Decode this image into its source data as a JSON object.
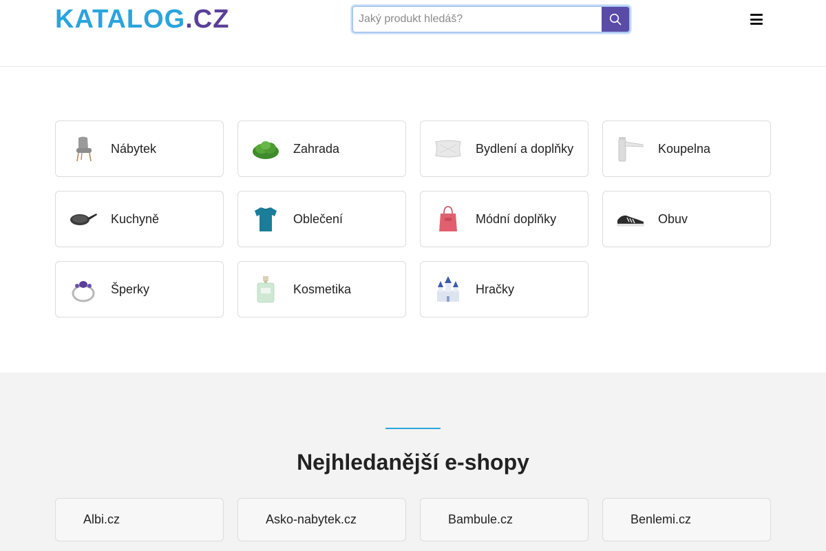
{
  "header": {
    "logo_main": "KATALOG",
    "logo_tld": ".CZ",
    "search_placeholder": "Jaký produkt hledáš?",
    "search_icon": "search-icon",
    "menu_icon": "hamburger-menu-icon"
  },
  "categories": [
    {
      "label": "Nábytek",
      "icon": "chair-icon"
    },
    {
      "label": "Zahrada",
      "icon": "shrub-icon"
    },
    {
      "label": "Bydlení a doplňky",
      "icon": "pillow-icon"
    },
    {
      "label": "Koupelna",
      "icon": "faucet-icon"
    },
    {
      "label": "Kuchyně",
      "icon": "frying-pan-icon"
    },
    {
      "label": "Oblečení",
      "icon": "tshirt-icon"
    },
    {
      "label": "Módní doplňky",
      "icon": "handbag-icon"
    },
    {
      "label": "Obuv",
      "icon": "sneaker-icon"
    },
    {
      "label": "Šperky",
      "icon": "ring-icon"
    },
    {
      "label": "Kosmetika",
      "icon": "perfume-icon"
    },
    {
      "label": "Hračky",
      "icon": "castle-toy-icon"
    }
  ],
  "shops_section": {
    "title": "Nejhledanější e-shopy",
    "shops": [
      {
        "label": "Albi.cz"
      },
      {
        "label": "Asko-nabytek.cz"
      },
      {
        "label": "Bambule.cz"
      },
      {
        "label": "Benlemi.cz"
      }
    ]
  },
  "colors": {
    "brand_blue": "#2aa4dc",
    "brand_purple": "#5a3f99",
    "search_button": "#5a4ba6"
  }
}
